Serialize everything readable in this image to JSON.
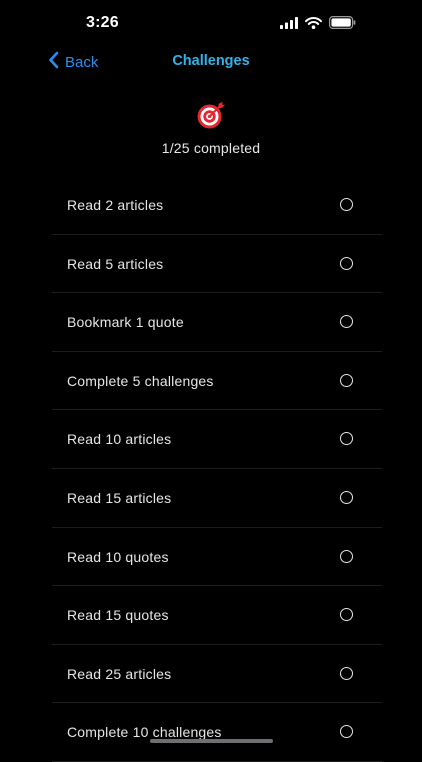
{
  "status_bar": {
    "time": "3:26",
    "icons": [
      "cellular-signal-icon",
      "wifi-icon",
      "battery-icon"
    ]
  },
  "nav": {
    "back_label": "Back",
    "title": "Challenges",
    "back_color": "#2d8cf0",
    "title_color": "#35b1e6"
  },
  "summary": {
    "icon": "target-icon",
    "completed_text": "1/25 completed",
    "icon_color": "#e3262f"
  },
  "challenges": [
    {
      "label": "Read 2 articles",
      "completed": false
    },
    {
      "label": "Read 5 articles",
      "completed": false
    },
    {
      "label": "Bookmark 1 quote",
      "completed": false
    },
    {
      "label": "Complete 5 challenges",
      "completed": false
    },
    {
      "label": "Read 10 articles",
      "completed": false
    },
    {
      "label": "Read 15 articles",
      "completed": false
    },
    {
      "label": "Read 10 quotes",
      "completed": false
    },
    {
      "label": "Read 15 quotes",
      "completed": false
    },
    {
      "label": "Read 25 articles",
      "completed": false
    },
    {
      "label": "Complete 10 challenges",
      "completed": false
    }
  ]
}
